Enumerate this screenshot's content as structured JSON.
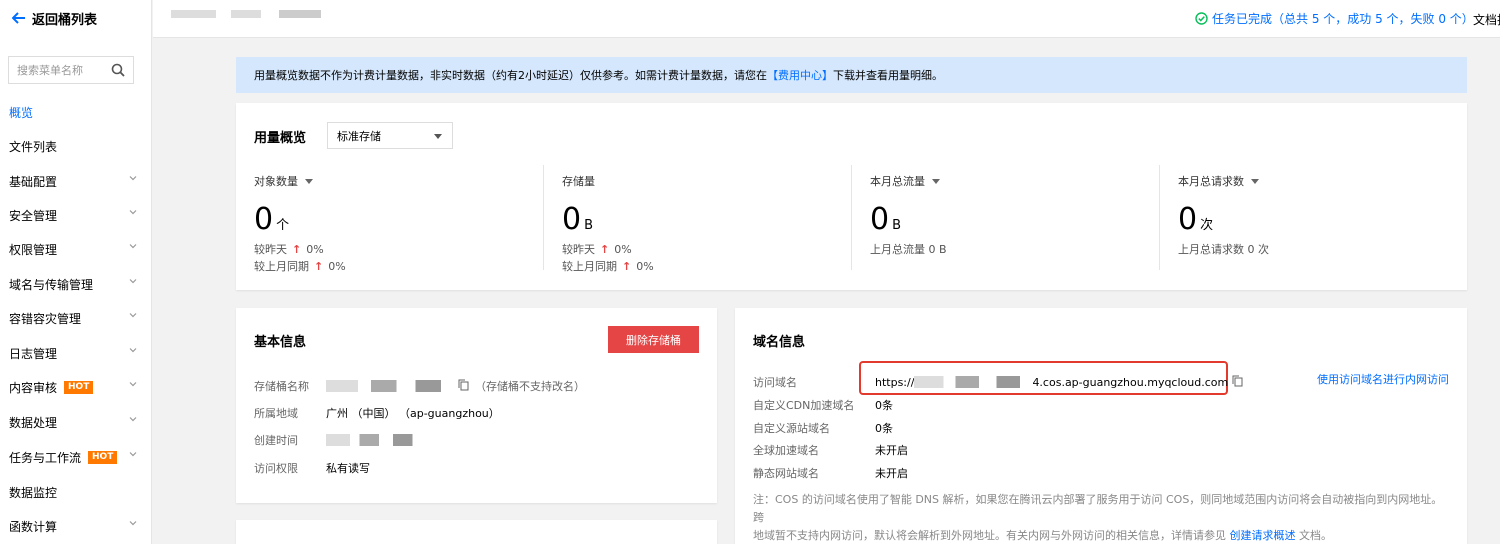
{
  "sidebar": {
    "back_label": "返回桶列表",
    "search_placeholder": "搜索菜单名称",
    "items": [
      {
        "label": "概览",
        "active": true,
        "chevron": false,
        "hot": false
      },
      {
        "label": "文件列表",
        "active": false,
        "chevron": false,
        "hot": false
      },
      {
        "label": "基础配置",
        "active": false,
        "chevron": true,
        "hot": false
      },
      {
        "label": "安全管理",
        "active": false,
        "chevron": true,
        "hot": false
      },
      {
        "label": "权限管理",
        "active": false,
        "chevron": true,
        "hot": false
      },
      {
        "label": "域名与传输管理",
        "active": false,
        "chevron": true,
        "hot": false
      },
      {
        "label": "容错容灾管理",
        "active": false,
        "chevron": true,
        "hot": false
      },
      {
        "label": "日志管理",
        "active": false,
        "chevron": true,
        "hot": false
      },
      {
        "label": "内容审核",
        "active": false,
        "chevron": true,
        "hot": true
      },
      {
        "label": "数据处理",
        "active": false,
        "chevron": true,
        "hot": false
      },
      {
        "label": "任务与工作流",
        "active": false,
        "chevron": true,
        "hot": true
      },
      {
        "label": "数据监控",
        "active": false,
        "chevron": false,
        "hot": false
      },
      {
        "label": "函数计算",
        "active": false,
        "chevron": true,
        "hot": false
      }
    ],
    "hot_badge": "HOT"
  },
  "topbar": {
    "task_status": "任务已完成（总共 5 个，成功 5 个，失败 0 个）",
    "doc_link": "文档指"
  },
  "notice": {
    "text_before": "用量概览数据不作为计费计量数据，非实时数据（约有2小时延迟）仅供参考。如需计费计量数据，请您在",
    "link": "【费用中心】",
    "text_after": "下载并查看用量明细。"
  },
  "usage": {
    "title": "用量概览",
    "storage_type": "标准存储",
    "stats": [
      {
        "label": "对象数量",
        "value": "0",
        "unit": "个",
        "dropdown": true,
        "lines": [
          {
            "text": "较昨天",
            "arrow": "↑",
            "pct": "0%"
          },
          {
            "text": "较上月同期",
            "arrow": "↑",
            "pct": "0%"
          }
        ]
      },
      {
        "label": "存储量",
        "value": "0",
        "unit": "B",
        "dropdown": false,
        "lines": [
          {
            "text": "较昨天",
            "arrow": "↑",
            "pct": "0%"
          },
          {
            "text": "较上月同期",
            "arrow": "↑",
            "pct": "0%"
          }
        ]
      },
      {
        "label": "本月总流量",
        "value": "0",
        "unit": "B",
        "dropdown": true,
        "lines": [
          {
            "text": "上月总流量 0 B",
            "arrow": "",
            "pct": ""
          }
        ]
      },
      {
        "label": "本月总请求数",
        "value": "0",
        "unit": "次",
        "dropdown": true,
        "lines": [
          {
            "text": "上月总请求数 0 次",
            "arrow": "",
            "pct": ""
          }
        ]
      }
    ]
  },
  "basic": {
    "title": "基本信息",
    "delete_button": "删除存储桶",
    "rows": [
      {
        "key": "存储桶名称",
        "value": "",
        "note": "（存储桶不支持改名）"
      },
      {
        "key": "所属地域",
        "value": "广州 （中国） （ap-guangzhou）",
        "note": ""
      },
      {
        "key": "创建时间",
        "value": "",
        "note": ""
      },
      {
        "key": "访问权限",
        "value": "私有读写",
        "note": ""
      }
    ]
  },
  "domain": {
    "title": "域名信息",
    "inner_link": "使用访问域名进行内网访问",
    "access_domain_key": "访问域名",
    "access_domain_prefix": "https://",
    "access_domain_suffix": "4.cos.ap-guangzhou.myqcloud.com",
    "rows": [
      {
        "key": "自定义CDN加速域名",
        "value": "0条"
      },
      {
        "key": "自定义源站域名",
        "value": "0条"
      },
      {
        "key": "全球加速域名",
        "value": "未开启"
      },
      {
        "key": "静态网站域名",
        "value": "未开启"
      }
    ],
    "note_line1": "注：COS 的访问域名使用了智能 DNS 解析，如果您在腾讯云内部署了服务用于访问 COS，则同地域范围内访问将会自动被指向到内网地址。跨",
    "note_line2_before": "地域暂不支持内网访问，默认将会解析到外网地址。有关内网与外网访问的相关信息，详情请参见",
    "note_link": "创建请求概述",
    "note_line2_after": "文档。"
  }
}
